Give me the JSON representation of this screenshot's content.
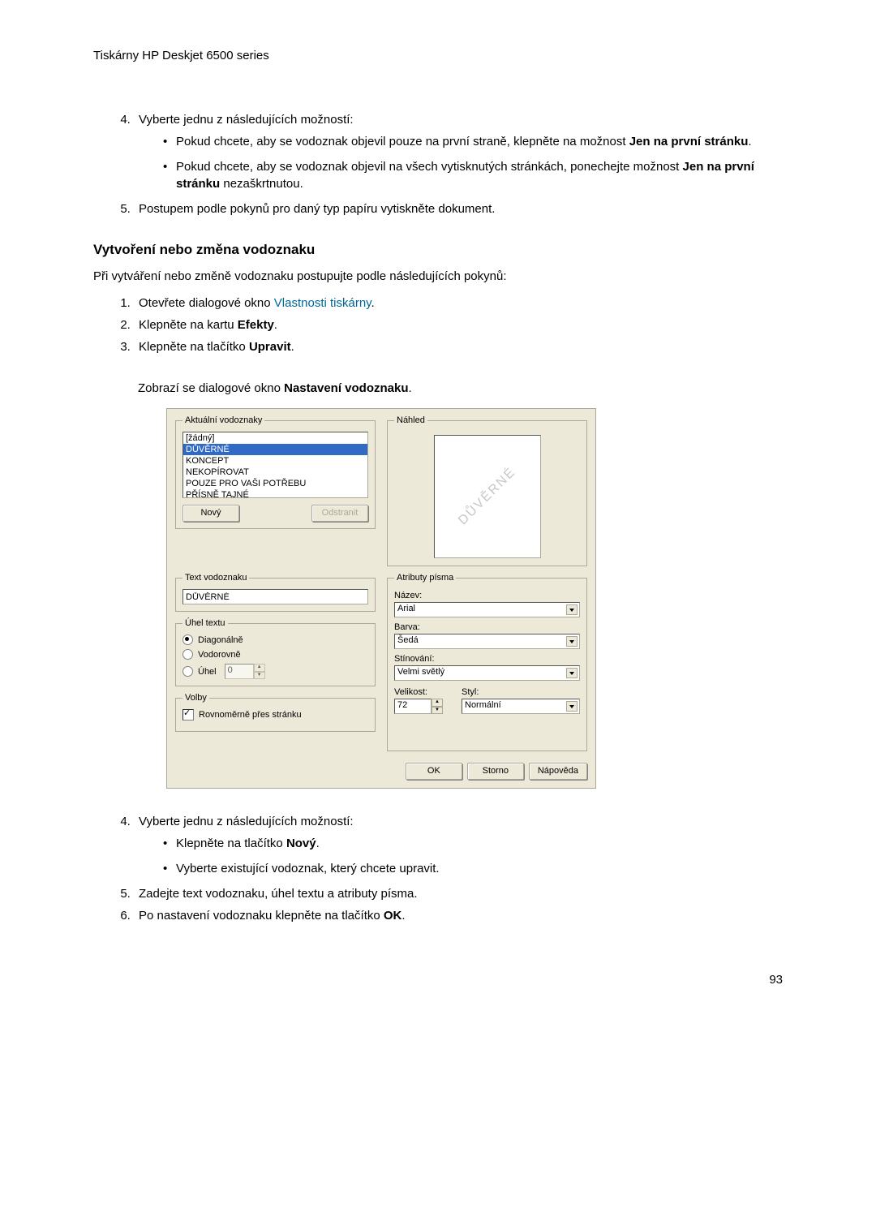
{
  "header": {
    "title": "Tiskárny HP Deskjet 6500 series"
  },
  "list1": {
    "item4": "Vyberte jednu z následujících možností:",
    "item4_bullets": {
      "b1a": "Pokud chcete, aby se vodoznak objevil pouze na první straně, klepněte na možnost ",
      "b1b": "Jen na první stránku",
      "b1c": ".",
      "b2a": "Pokud chcete, aby se vodoznak objevil na všech vytisknutých stránkách, ponechejte možnost ",
      "b2b": "Jen na první stránku",
      "b2c": " nezaškrtnutou."
    },
    "item5": "Postupem podle pokynů pro daný typ papíru vytiskněte dokument."
  },
  "section": {
    "heading": "Vytvoření nebo změna vodoznaku",
    "intro": "Při vytváření nebo změně vodoznaku postupujte podle následujících pokynů:"
  },
  "list2": {
    "item1a": "Otevřete dialogové okno ",
    "item1_link": "Vlastnosti tiskárny",
    "item1b": ".",
    "item2a": "Klepněte na kartu ",
    "item2b": "Efekty",
    "item2c": ".",
    "item3a": "Klepněte na tlačítko ",
    "item3b": "Upravit",
    "item3c": ".",
    "item3_para_a": "Zobrazí se dialogové okno ",
    "item3_para_b": "Nastavení vodoznaku",
    "item3_para_c": ".",
    "item4": "Vyberte jednu z následujících možností:",
    "item4_bullets": {
      "b1a": "Klepněte na tlačítko ",
      "b1b": "Nový",
      "b1c": ".",
      "b2": "Vyberte existující vodoznak, který chcete upravit."
    },
    "item5": "Zadejte text vodoznaku, úhel textu a atributy písma.",
    "item6a": "Po nastavení vodoznaku klepněte na tlačítko ",
    "item6b": "OK",
    "item6c": "."
  },
  "dialog": {
    "legend_current": "Aktuální vodoznaky",
    "legend_preview": "Náhled",
    "legend_text": "Text vodoznaku",
    "legend_angle": "Úhel textu",
    "legend_options": "Volby",
    "legend_font": "Atributy písma",
    "list": {
      "none": "[žádný]",
      "duverne": "DŮVĚRNÉ",
      "koncept": "KONCEPT",
      "nekopirovat": "NEKOPÍROVAT",
      "pouze": "POUZE PRO VAŠI POTŘEBU",
      "prisne": "PŘÍSNĚ TAJNÉ"
    },
    "new_btn": "Nový",
    "delete_btn": "Odstranit",
    "preview_text": "DŮVĚRNÉ",
    "text_value": "DŮVĚRNÉ",
    "angle_diagonal": "Diagonálně",
    "angle_horizontal": "Vodorovně",
    "angle_custom": "Úhel",
    "angle_value": "0",
    "option_even": "Rovnoměrně přes stránku",
    "font_name_label": "Název:",
    "font_name_value": "Arial",
    "font_color_label": "Barva:",
    "font_color_value": "Šedá",
    "font_shade_label": "Stínování:",
    "font_shade_value": "Velmi světlý",
    "font_size_label": "Velikost:",
    "font_size_value": "72",
    "font_style_label": "Styl:",
    "font_style_value": "Normální",
    "ok": "OK",
    "cancel": "Storno",
    "help": "Nápověda"
  },
  "page_number": "93"
}
